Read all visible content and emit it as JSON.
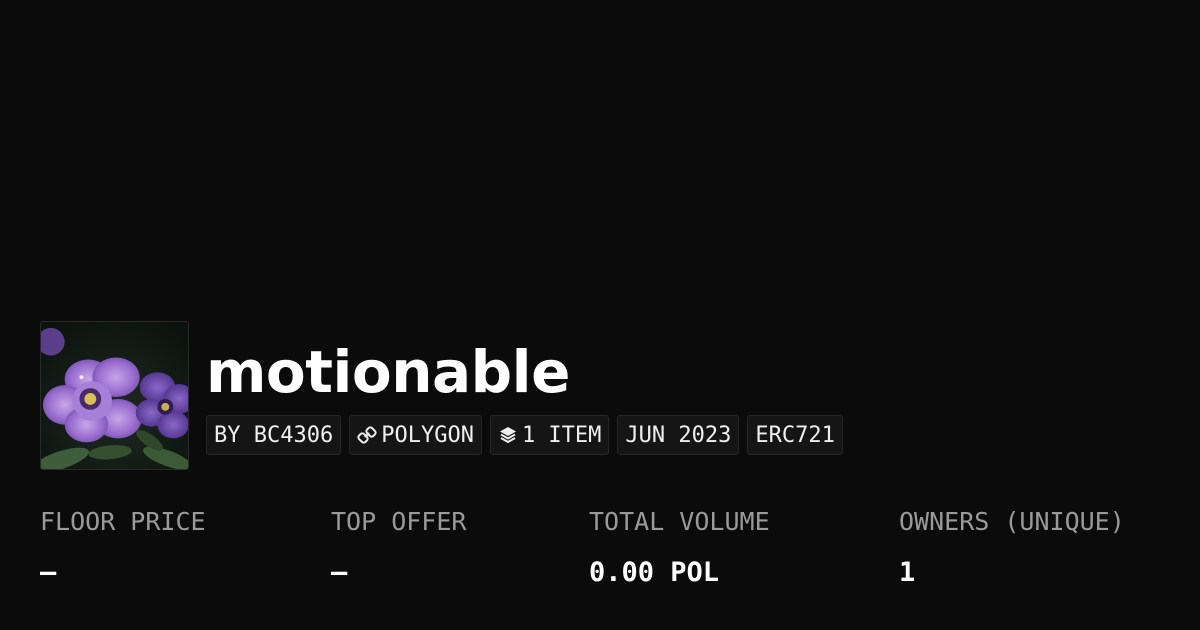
{
  "collection": {
    "title": "motionable",
    "chips": {
      "creator": "BY BC4306",
      "chain": "POLYGON",
      "items": "1 ITEM",
      "date": "JUN 2023",
      "standard": "ERC721"
    },
    "icons": {
      "thumbnail": "purple-flower-image",
      "chain": "link-icon",
      "items": "layers-icon"
    }
  },
  "stats": [
    {
      "label": "FLOOR PRICE",
      "value": "–"
    },
    {
      "label": "TOP OFFER",
      "value": "–"
    },
    {
      "label": "TOTAL VOLUME",
      "value": "0.00 POL"
    },
    {
      "label": "OWNERS (UNIQUE)",
      "value": "1"
    }
  ],
  "colors": {
    "background": "#0b0b0b",
    "chip_background": "#151515",
    "label": "#9a9a9a",
    "text": "#ffffff"
  }
}
